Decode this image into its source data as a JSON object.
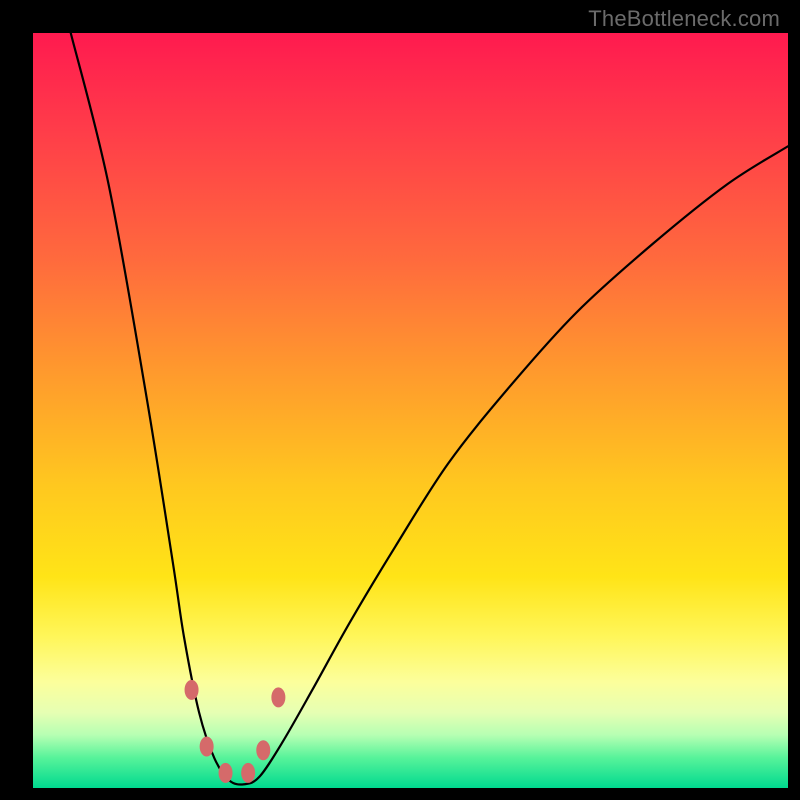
{
  "watermark": "TheBottleneck.com",
  "colors": {
    "frame": "#000000",
    "curve": "#000000",
    "marker": "#d56a6a",
    "gradient_top": "#ff1a4f",
    "gradient_bottom": "#00d98f"
  },
  "chart_data": {
    "type": "line",
    "title": "",
    "xlabel": "",
    "ylabel": "",
    "xlim": [
      0,
      100
    ],
    "ylim": [
      0,
      100
    ],
    "grid": false,
    "legend": false,
    "series": [
      {
        "name": "bottleneck-curve",
        "x": [
          5,
          10,
          15,
          18.5,
          20,
          22,
          24,
          26,
          28,
          30,
          33,
          37,
          42,
          48,
          55,
          63,
          72,
          82,
          92,
          100
        ],
        "values": [
          100,
          80,
          52,
          30,
          20,
          10,
          4,
          1,
          0.5,
          1.5,
          6,
          13,
          22,
          32,
          43,
          53,
          63,
          72,
          80,
          85
        ]
      }
    ],
    "annotations": [
      {
        "name": "marker-left-upper",
        "x": 21.0,
        "y": 13
      },
      {
        "name": "marker-left-lower",
        "x": 23.0,
        "y": 5.5
      },
      {
        "name": "marker-min-left",
        "x": 25.5,
        "y": 2.0
      },
      {
        "name": "marker-min-right",
        "x": 28.5,
        "y": 2.0
      },
      {
        "name": "marker-right-lower",
        "x": 30.5,
        "y": 5.0
      },
      {
        "name": "marker-right-upper",
        "x": 32.5,
        "y": 12
      }
    ]
  }
}
